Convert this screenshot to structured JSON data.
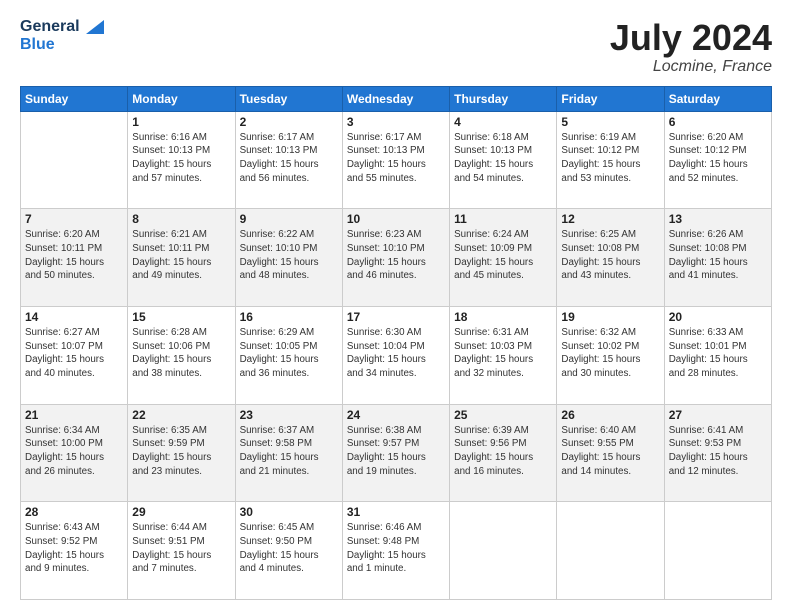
{
  "header": {
    "logo_line1": "General",
    "logo_line2": "Blue",
    "month": "July 2024",
    "location": "Locmine, France"
  },
  "days_of_week": [
    "Sunday",
    "Monday",
    "Tuesday",
    "Wednesday",
    "Thursday",
    "Friday",
    "Saturday"
  ],
  "weeks": [
    [
      {
        "day": "",
        "info": ""
      },
      {
        "day": "1",
        "info": "Sunrise: 6:16 AM\nSunset: 10:13 PM\nDaylight: 15 hours\nand 57 minutes."
      },
      {
        "day": "2",
        "info": "Sunrise: 6:17 AM\nSunset: 10:13 PM\nDaylight: 15 hours\nand 56 minutes."
      },
      {
        "day": "3",
        "info": "Sunrise: 6:17 AM\nSunset: 10:13 PM\nDaylight: 15 hours\nand 55 minutes."
      },
      {
        "day": "4",
        "info": "Sunrise: 6:18 AM\nSunset: 10:13 PM\nDaylight: 15 hours\nand 54 minutes."
      },
      {
        "day": "5",
        "info": "Sunrise: 6:19 AM\nSunset: 10:12 PM\nDaylight: 15 hours\nand 53 minutes."
      },
      {
        "day": "6",
        "info": "Sunrise: 6:20 AM\nSunset: 10:12 PM\nDaylight: 15 hours\nand 52 minutes."
      }
    ],
    [
      {
        "day": "7",
        "info": "Sunrise: 6:20 AM\nSunset: 10:11 PM\nDaylight: 15 hours\nand 50 minutes."
      },
      {
        "day": "8",
        "info": "Sunrise: 6:21 AM\nSunset: 10:11 PM\nDaylight: 15 hours\nand 49 minutes."
      },
      {
        "day": "9",
        "info": "Sunrise: 6:22 AM\nSunset: 10:10 PM\nDaylight: 15 hours\nand 48 minutes."
      },
      {
        "day": "10",
        "info": "Sunrise: 6:23 AM\nSunset: 10:10 PM\nDaylight: 15 hours\nand 46 minutes."
      },
      {
        "day": "11",
        "info": "Sunrise: 6:24 AM\nSunset: 10:09 PM\nDaylight: 15 hours\nand 45 minutes."
      },
      {
        "day": "12",
        "info": "Sunrise: 6:25 AM\nSunset: 10:08 PM\nDaylight: 15 hours\nand 43 minutes."
      },
      {
        "day": "13",
        "info": "Sunrise: 6:26 AM\nSunset: 10:08 PM\nDaylight: 15 hours\nand 41 minutes."
      }
    ],
    [
      {
        "day": "14",
        "info": "Sunrise: 6:27 AM\nSunset: 10:07 PM\nDaylight: 15 hours\nand 40 minutes."
      },
      {
        "day": "15",
        "info": "Sunrise: 6:28 AM\nSunset: 10:06 PM\nDaylight: 15 hours\nand 38 minutes."
      },
      {
        "day": "16",
        "info": "Sunrise: 6:29 AM\nSunset: 10:05 PM\nDaylight: 15 hours\nand 36 minutes."
      },
      {
        "day": "17",
        "info": "Sunrise: 6:30 AM\nSunset: 10:04 PM\nDaylight: 15 hours\nand 34 minutes."
      },
      {
        "day": "18",
        "info": "Sunrise: 6:31 AM\nSunset: 10:03 PM\nDaylight: 15 hours\nand 32 minutes."
      },
      {
        "day": "19",
        "info": "Sunrise: 6:32 AM\nSunset: 10:02 PM\nDaylight: 15 hours\nand 30 minutes."
      },
      {
        "day": "20",
        "info": "Sunrise: 6:33 AM\nSunset: 10:01 PM\nDaylight: 15 hours\nand 28 minutes."
      }
    ],
    [
      {
        "day": "21",
        "info": "Sunrise: 6:34 AM\nSunset: 10:00 PM\nDaylight: 15 hours\nand 26 minutes."
      },
      {
        "day": "22",
        "info": "Sunrise: 6:35 AM\nSunset: 9:59 PM\nDaylight: 15 hours\nand 23 minutes."
      },
      {
        "day": "23",
        "info": "Sunrise: 6:37 AM\nSunset: 9:58 PM\nDaylight: 15 hours\nand 21 minutes."
      },
      {
        "day": "24",
        "info": "Sunrise: 6:38 AM\nSunset: 9:57 PM\nDaylight: 15 hours\nand 19 minutes."
      },
      {
        "day": "25",
        "info": "Sunrise: 6:39 AM\nSunset: 9:56 PM\nDaylight: 15 hours\nand 16 minutes."
      },
      {
        "day": "26",
        "info": "Sunrise: 6:40 AM\nSunset: 9:55 PM\nDaylight: 15 hours\nand 14 minutes."
      },
      {
        "day": "27",
        "info": "Sunrise: 6:41 AM\nSunset: 9:53 PM\nDaylight: 15 hours\nand 12 minutes."
      }
    ],
    [
      {
        "day": "28",
        "info": "Sunrise: 6:43 AM\nSunset: 9:52 PM\nDaylight: 15 hours\nand 9 minutes."
      },
      {
        "day": "29",
        "info": "Sunrise: 6:44 AM\nSunset: 9:51 PM\nDaylight: 15 hours\nand 7 minutes."
      },
      {
        "day": "30",
        "info": "Sunrise: 6:45 AM\nSunset: 9:50 PM\nDaylight: 15 hours\nand 4 minutes."
      },
      {
        "day": "31",
        "info": "Sunrise: 6:46 AM\nSunset: 9:48 PM\nDaylight: 15 hours\nand 1 minute."
      },
      {
        "day": "",
        "info": ""
      },
      {
        "day": "",
        "info": ""
      },
      {
        "day": "",
        "info": ""
      }
    ]
  ]
}
